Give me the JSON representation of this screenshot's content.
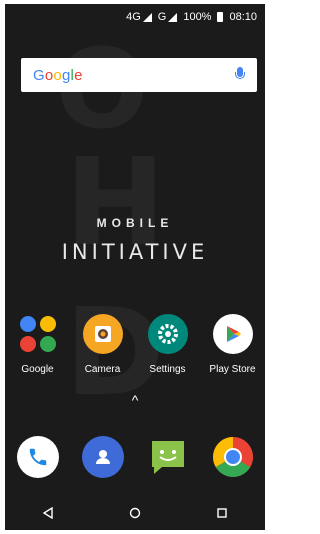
{
  "status_bar": {
    "network_1": "4G",
    "network_2": "G",
    "battery_pct": "100%",
    "time": "08:10"
  },
  "search": {
    "logo": "Google"
  },
  "branding": {
    "line1": "MOBILE",
    "line2": "INITIATIVE"
  },
  "apps": [
    {
      "label": "Google"
    },
    {
      "label": "Camera"
    },
    {
      "label": "Settings"
    },
    {
      "label": "Play Store"
    }
  ],
  "app_drawer_handle": "^",
  "colors": {
    "background": "#1b1b1b",
    "google_blue": "#4285f4",
    "google_red": "#ea4335",
    "google_yellow": "#fbbc05",
    "google_green": "#34a853",
    "camera_orange": "#f5a623",
    "settings_teal": "#00897b",
    "messages_green": "#8bc34a"
  },
  "icons": {
    "dock": [
      "phone-icon",
      "contacts-icon",
      "messages-icon",
      "chrome-icon"
    ],
    "nav": [
      "back-icon",
      "home-icon",
      "recents-icon"
    ]
  }
}
